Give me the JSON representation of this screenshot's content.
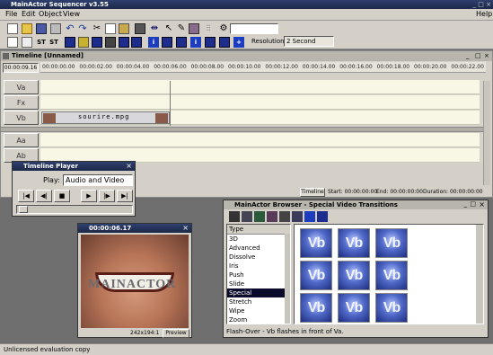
{
  "app": {
    "title": "MainActor Sequencer v3.55"
  },
  "menu": {
    "file": "File",
    "edit": "Edit",
    "object": "Object",
    "view": "View",
    "help": "Help"
  },
  "toolbar": {
    "resolution_label": "Resolution:",
    "resolution_value": "2 Second"
  },
  "timeline": {
    "title": "Timeline [Unnamed]",
    "current_time": "00:00:09.16",
    "ruler": [
      "00:00:00.00",
      "00:00:02.00",
      "00:00:04.00",
      "00:00:06.00",
      "00:00:08.00",
      "00:00:10.00",
      "00:00:12.00",
      "00:00:14.00",
      "00:00:16.00",
      "00:00:18.00",
      "00:00:20.00",
      "00:00:22.00"
    ],
    "tracks": [
      "Va",
      "Fx",
      "Vb",
      "Aa",
      "Ab"
    ],
    "clip_name": "sourire.mpg",
    "status": {
      "tab": "Timeline",
      "start": "Start: 00:00:00:00",
      "end": "End: 00:00:00:00",
      "duration": "Duration: 00:00:00:00"
    }
  },
  "player": {
    "title": "Timeline Player",
    "play_label": "Play:",
    "play_value": "Audio and Video"
  },
  "preview": {
    "time": "00:00:06.17",
    "size": "242x194:1",
    "btn": "Preview",
    "overlay": "MAINACTOR"
  },
  "browser": {
    "title": "MainActor Browser - Special Video Transitions",
    "list_header": "Type",
    "types": [
      "3D",
      "Advanced",
      "Dissolve",
      "Iris",
      "Push",
      "Slide",
      "Special",
      "Stretch",
      "Wipe",
      "Zoom"
    ],
    "selected": "Special",
    "thumb_label": "Vb",
    "thumb_count": 9,
    "status": "Flash-Over - Vb flashes in front of Va."
  },
  "statusbar": {
    "text": "Unlicensed evaluation copy"
  }
}
